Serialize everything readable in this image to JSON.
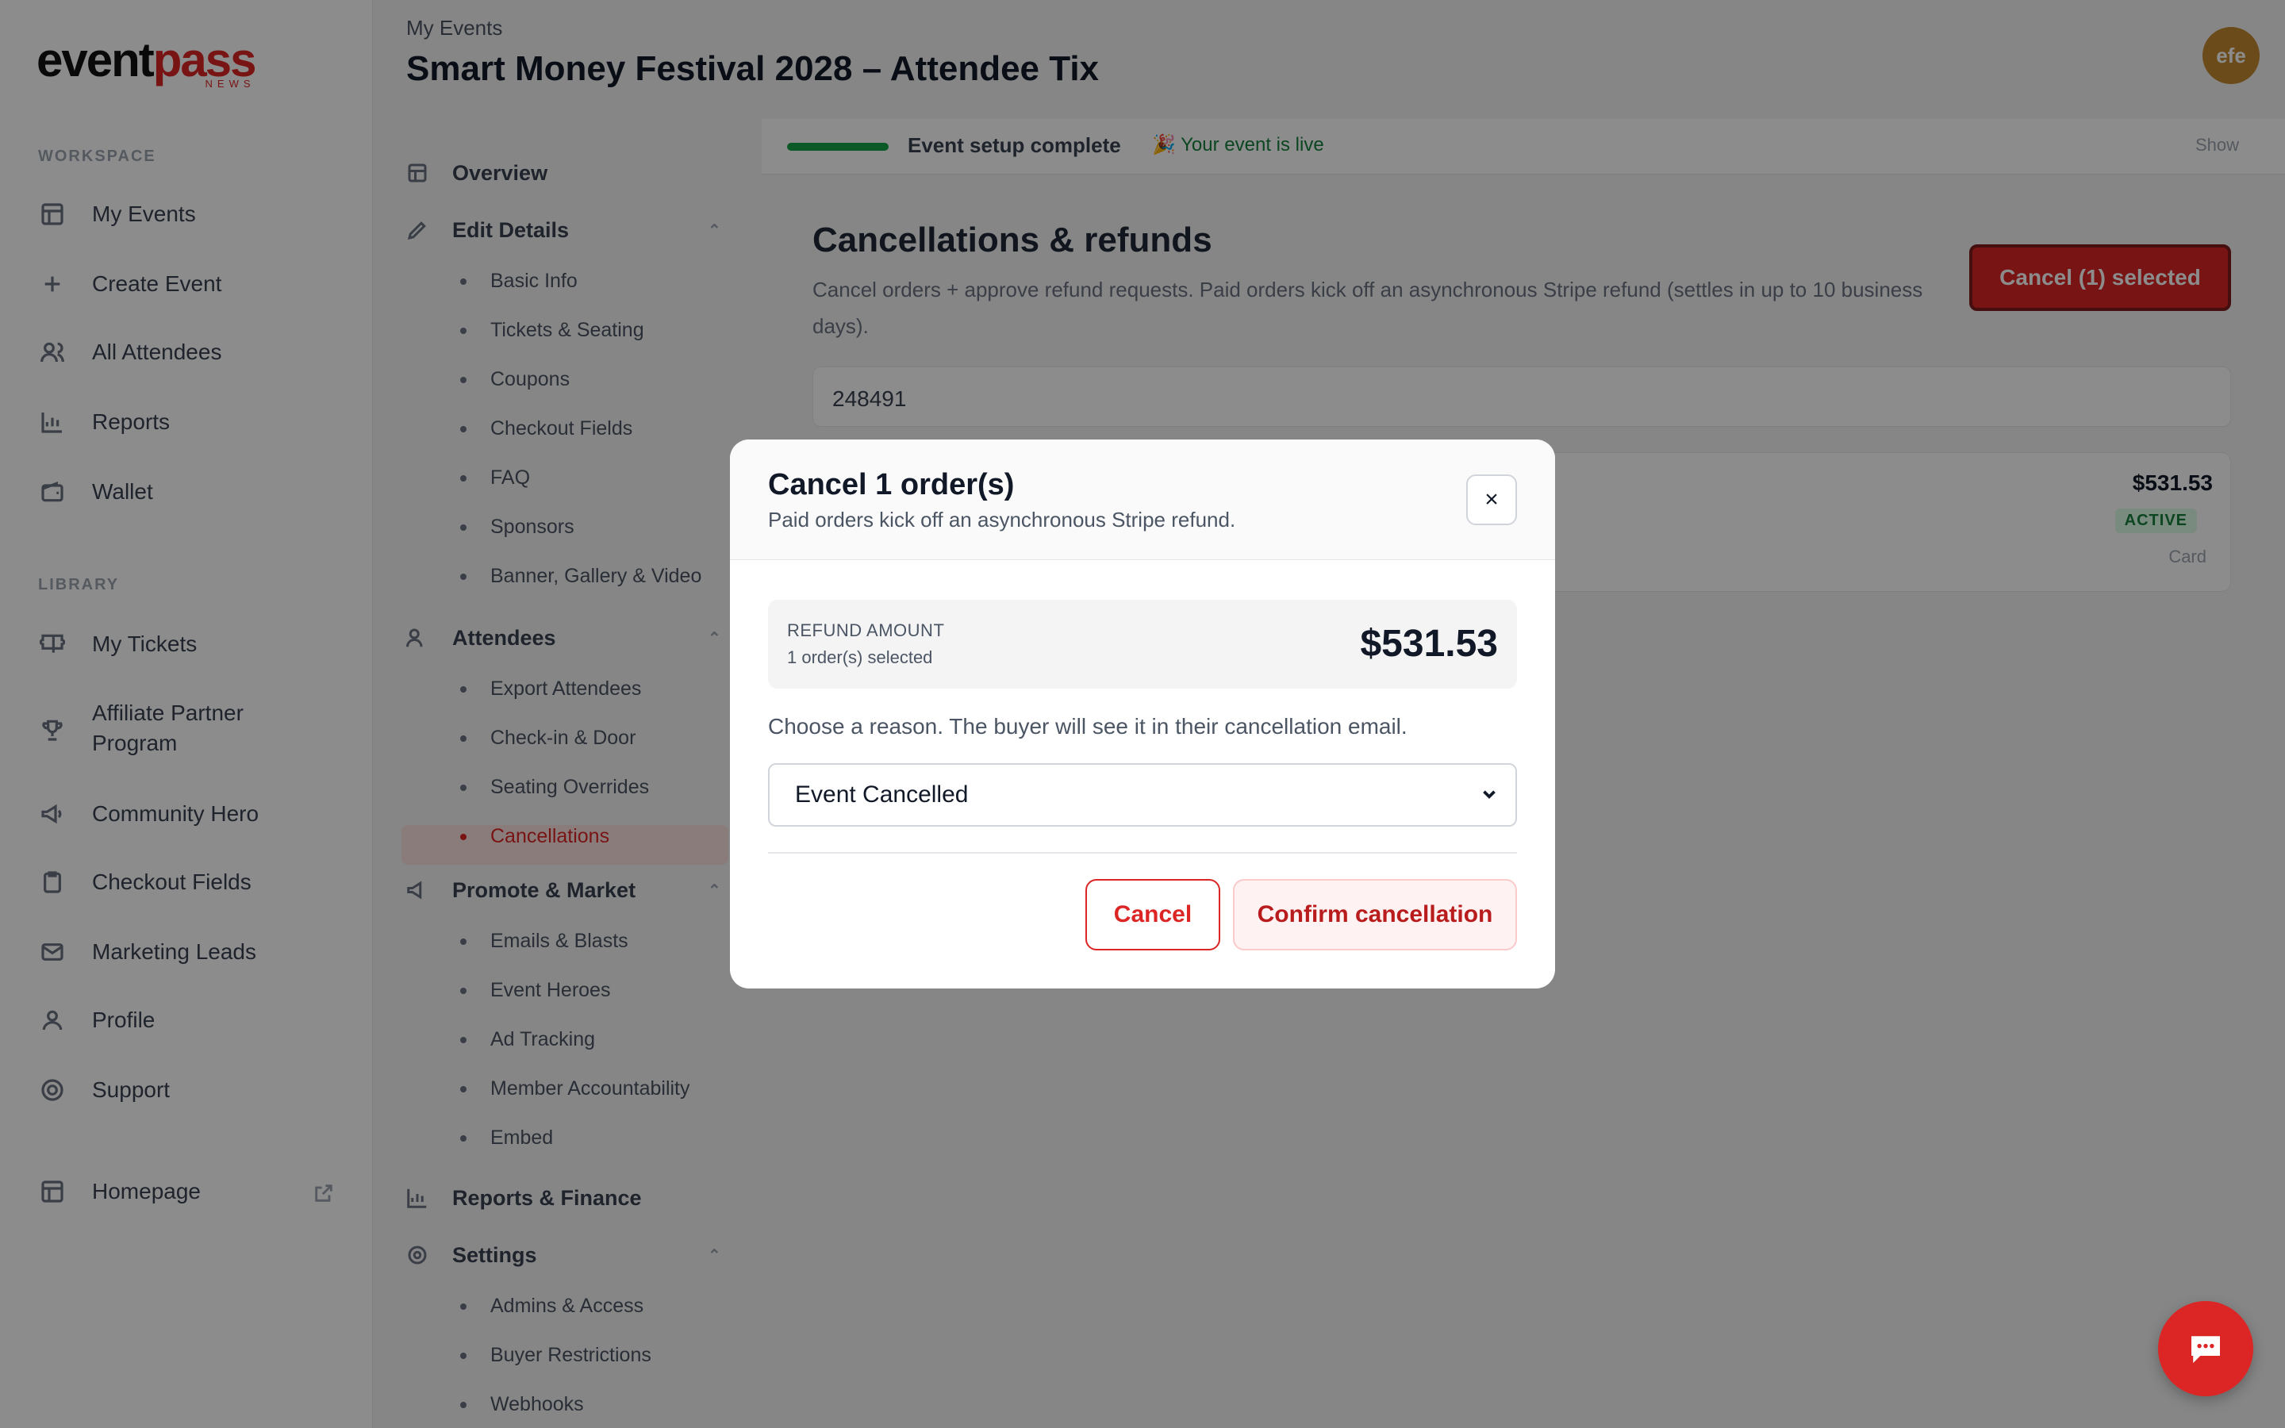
{
  "brand": {
    "logo_part1": "event",
    "logo_part2": "pass",
    "logo_sub": "NEWS",
    "accent": "#dc2626"
  },
  "sidebar": {
    "workspace_label": "WORKSPACE",
    "library_label": "LIBRARY",
    "items": [
      {
        "label": "My Events",
        "icon": "grid-icon"
      },
      {
        "label": "Create Event",
        "icon": "plus-icon"
      },
      {
        "label": "All Attendees",
        "icon": "users-icon"
      },
      {
        "label": "Reports",
        "icon": "chart-icon"
      },
      {
        "label": "Wallet",
        "icon": "wallet-icon"
      }
    ],
    "library_items": [
      {
        "label": "My Tickets",
        "icon": "ticket-icon"
      },
      {
        "label": "Affiliate Partner Program",
        "icon": "trophy-icon"
      },
      {
        "label": "Community Hero",
        "icon": "megaphone-icon"
      },
      {
        "label": "Checkout Fields",
        "icon": "clipboard-icon"
      },
      {
        "label": "Marketing Leads",
        "icon": "mail-icon"
      },
      {
        "label": "Profile",
        "icon": "user-icon"
      },
      {
        "label": "Support",
        "icon": "help-icon"
      }
    ],
    "homepage": "Homepage"
  },
  "header": {
    "breadcrumb": "My Events",
    "title": "Smart Money Festival 2028 – Attendee Tix",
    "avatar_initials": "efe"
  },
  "subnav": {
    "overview": "Overview",
    "edit_details": "Edit Details",
    "edit_children": [
      "Basic Info",
      "Tickets & Seating",
      "Coupons",
      "Checkout Fields",
      "FAQ",
      "Sponsors",
      "Banner, Gallery & Video"
    ],
    "attendees": "Attendees",
    "attendee_children": [
      "Export Attendees",
      "Check-in & Door",
      "Seating Overrides",
      "Cancellations"
    ],
    "promote": "Promote & Market",
    "promote_children": [
      "Emails & Blasts",
      "Event Heroes",
      "Ad Tracking",
      "Member Accountability",
      "Embed"
    ],
    "reports": "Reports & Finance",
    "settings": "Settings",
    "settings_children": [
      "Admins & Access",
      "Buyer Restrictions",
      "Webhooks"
    ]
  },
  "status": {
    "progress_fraction": 1.0,
    "setup": "Event setup complete",
    "live": "🎉 Your event is live",
    "show": "Show"
  },
  "main": {
    "title": "Cancellations & refunds",
    "subtitle": "Cancel orders + approve refund requests. Paid orders kick off an asynchronous Stripe refund (settles in up to 10 business days).",
    "cancel_selected": "Cancel (1) selected",
    "search_value": "248491",
    "order": {
      "amount": "$531.53",
      "status": "ACTIVE",
      "method": "Card"
    }
  },
  "modal": {
    "title": "Cancel 1 order(s)",
    "subtitle": "Paid orders kick off an asynchronous Stripe refund.",
    "close": "×",
    "refund_label": "REFUND AMOUNT",
    "refund_count": "1 order(s) selected",
    "refund_amount": "$531.53",
    "reason_prompt": "Choose a reason. The buyer will see it in their cancellation email.",
    "reason_selected": "Event Cancelled",
    "cancel_label": "Cancel",
    "confirm_label": "Confirm cancellation"
  }
}
